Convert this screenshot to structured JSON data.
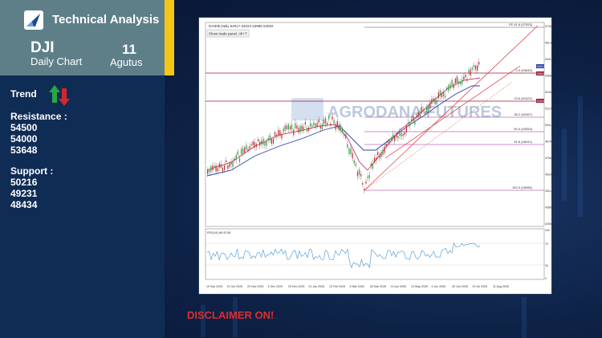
{
  "header": {
    "brand": "Technical Analysis",
    "symbol": "DJI",
    "chart_type": "Daily Chart",
    "day": "11",
    "month": "Agutus"
  },
  "analysis": {
    "trend_label": "Trend",
    "resistance_label": "Resistance :",
    "resistance": [
      "54500",
      "54000",
      "53648"
    ],
    "support_label": "Support :",
    "support": [
      "50216",
      "49231",
      "48434"
    ]
  },
  "chart": {
    "header_text": "DJI30b,Daily 54017 54023 53996 54002",
    "tooltip": "Show trade panel, Alt+T",
    "watermark": "AGRODANA FUTURES",
    "indicator_label": "RSI(14) 66.6746",
    "fib_labels": [
      "FE 61.8 (57053)",
      "0.0 (53643)",
      "23.6 (51621)",
      "38.2 (50367)",
      "50.0 (49354)",
      "61.8 (48341)",
      "100.0 (45065)"
    ],
    "price_ticks": [
      "57364",
      "56139",
      "54914",
      "53689",
      "52464",
      "51239",
      "50014",
      "48789",
      "47564",
      "46339",
      "45114",
      "43889",
      "42664"
    ],
    "rsi_ticks": [
      "100",
      "70",
      "30",
      "0"
    ],
    "x_ticks": [
      "19 Sep 2025",
      "21 Oct 2025",
      "20 Nov 2025",
      "4 Dec 2025",
      "29 Dec 2025",
      "21 Jan 2026",
      "12 Feb 2026",
      "6 Mar 2026",
      "30 Mar 2026",
      "21 Apr 2026",
      "13 May 2026",
      "4 Jun 2026",
      "26 Jun 2026",
      "20 Jul 2026",
      "11 Aug 2026"
    ],
    "price_tags": [
      "54017",
      "53643",
      "51621"
    ]
  },
  "disclaimer": "DISCLAIMER ON!",
  "colors": {
    "accent": "#f5c518",
    "panel": "#0f2c55",
    "header": "#5e7f88",
    "disclaimer": "#e02b2b",
    "up": "#27a844",
    "down": "#d3262e"
  }
}
